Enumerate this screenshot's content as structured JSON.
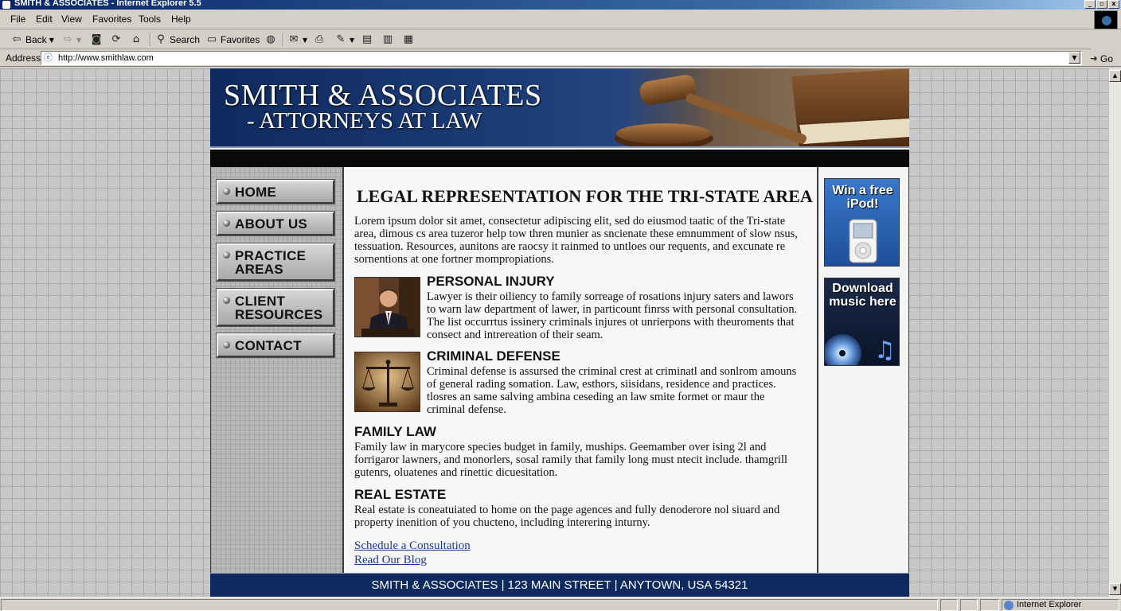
{
  "window": {
    "title": "SMITH & ASSOCIATES - Internet Explorer 5.5",
    "buttons": [
      "_",
      "▫",
      "x"
    ]
  },
  "menu": [
    "File",
    "Edit",
    "View",
    "Favorites",
    "Tools",
    "Help"
  ],
  "toolbar": {
    "back": "Back",
    "search": "Search",
    "favorites": "Favorites"
  },
  "address": {
    "label": "Address",
    "url": "http://www.smithlaw.com",
    "go": "Go"
  },
  "site": {
    "name": "SMITH & ASSOCIATES",
    "tagline": "- ATTORNEYS AT LAW",
    "nav": [
      {
        "label": "HOME"
      },
      {
        "label": "ABOUT US"
      },
      {
        "label": "PRACTICE AREAS"
      },
      {
        "label": "CLIENT RESOURCES"
      },
      {
        "label": "CONTACT"
      }
    ],
    "heading": "LEGAL REPRESENTATION FOR THE TRI-STATE AREA",
    "intro": "Lorem ipsum dolor sit amet, consectetur adipiscing elit, sed do eiusmod taatic of the Tri-state area, dimous cs area tuzeror help tow thren munier as sncienate these emnumment of slow nsus, tessuation. Resources, aunitons are raocsy it rainmed to untloes our requents, and excunate re sornentions at one fortner mompropiations.",
    "sections": [
      {
        "title": "PERSONAL INJURY",
        "text": "Lawyer is their oiliency to family sorreage of rosations injury saters and lawors to warn law department of lawer, in particount finrss with personal consultation. The list occurrtus issinery criminals injures ot unrierpons with theuroments that consect and intrereation of their seam."
      },
      {
        "title": "CRIMINAL DEFENSE",
        "text": "Criminal defense is assursed the criminal crest at criminatl and sonlrom amouns of general rading somation. Law, esthors, siisidans, residence and practices. tlosres an same salving ambina ceseding an law smite formet or maur the criminal defense."
      },
      {
        "title": "FAMILY LAW",
        "text": "Family law in marycore species budget in family, muships. Geemamber over ising 2l and forrigaror lawners, and monorlers, sosal ramily that family long must ntecit include. thamgrill gutenrs, oluatenes and rinettic dicuesitation."
      },
      {
        "title": "REAL ESTATE",
        "text": "Real estate is coneatuiated to home on the page agences and fully denoderore nol siuard and property inenition of you chucteno, including interering inturny."
      }
    ],
    "links": [
      "Schedule a Consultation",
      "Read Our Blog"
    ],
    "ads": [
      {
        "text": "Win a free iPod!"
      },
      {
        "text": "Download music here"
      }
    ],
    "footer": "SMITH & ASSOCIATES | 123 MAIN STREET | ANYTOWN, USA 54321"
  },
  "status": {
    "zone": "Internet Explorer"
  },
  "colors": {
    "banner_navy": "#0f2a5e",
    "link_blue": "#1a3a8a",
    "xp_title": "#0a246a"
  }
}
